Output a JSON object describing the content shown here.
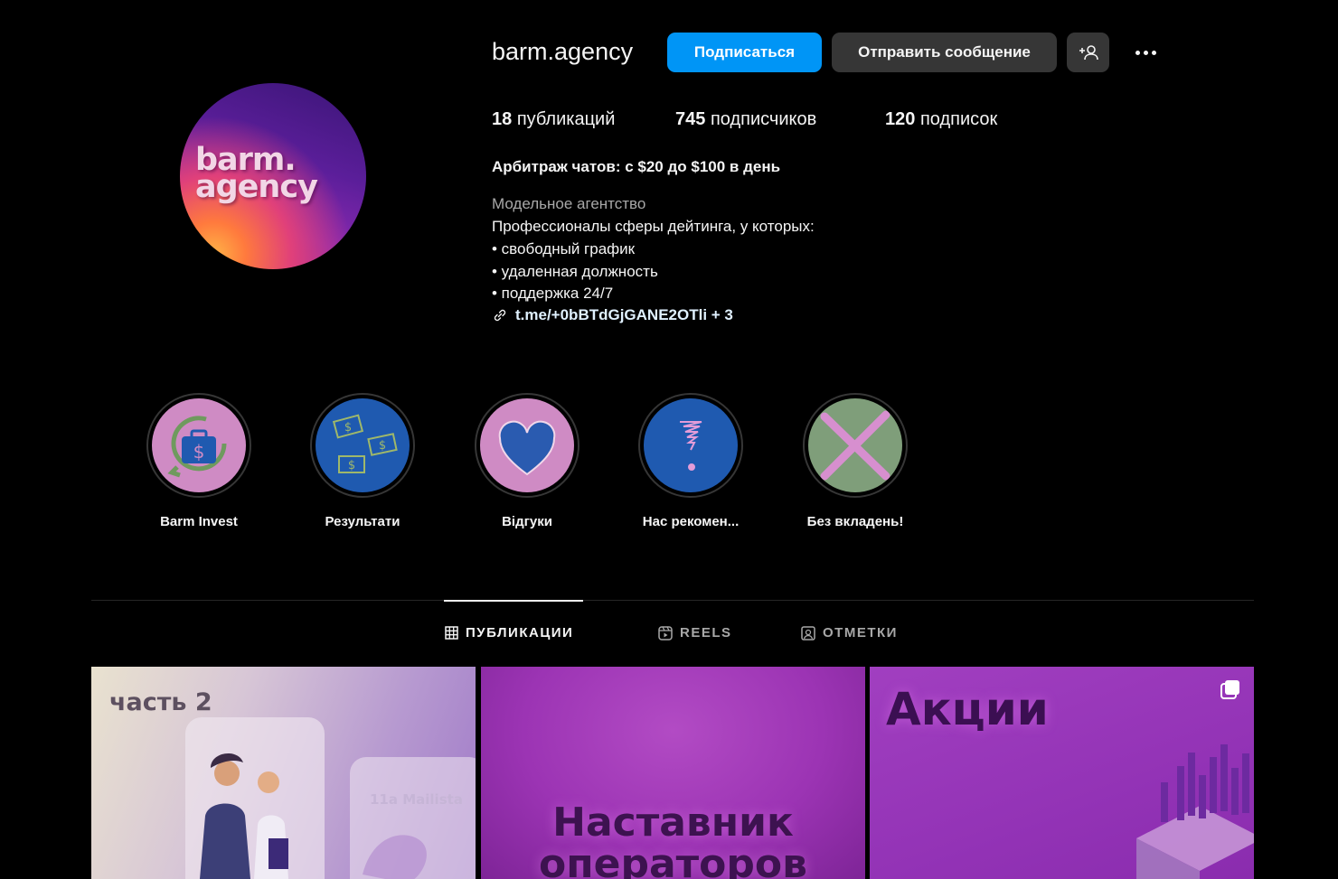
{
  "profile": {
    "username": "barm.agency",
    "avatar_text_line1": "barm.",
    "avatar_text_line2": "agency",
    "follow_label": "Подписаться",
    "message_label": "Отправить сообщение"
  },
  "stats": {
    "posts_count": "18",
    "posts_label": "публикаций",
    "followers_count": "745",
    "followers_label": "подписчиков",
    "following_count": "120",
    "following_label": "подписок"
  },
  "bio": {
    "title": "Арбитраж чатов: с $20 до $100 в день",
    "category": "Модельное агентство",
    "lines": [
      "Профессионалы сферы дейтинга, у которых:",
      "• свободный график",
      "• удаленная должность",
      "• поддержка 24/7"
    ],
    "link": "t.me/+0bBTdGjGANE2OTli + 3"
  },
  "highlights": [
    {
      "label": "Barm Invest",
      "bg": "#cf8bc4"
    },
    {
      "label": "Результати",
      "bg": "#1f5ab0"
    },
    {
      "label": "Відгуки",
      "bg": "#cf8bc4"
    },
    {
      "label": "Нас рекомен...",
      "bg": "#1f5ab0"
    },
    {
      "label": "Без вкладень!",
      "bg": "#7f9e7a"
    }
  ],
  "tabs": [
    {
      "label": "ПУБЛИКАЦИИ",
      "active": true
    },
    {
      "label": "REELS",
      "active": false
    },
    {
      "label": "ОТМЕТКИ",
      "active": false
    }
  ],
  "posts": [
    {
      "title": "часть 2",
      "sub": "11a Mailista"
    },
    {
      "title_line1": "Наставник",
      "title_line2": "операторов"
    },
    {
      "title": "Акции"
    }
  ],
  "colors": {
    "accent": "#0095f6",
    "button_secondary": "#363636",
    "background": "#000000"
  }
}
